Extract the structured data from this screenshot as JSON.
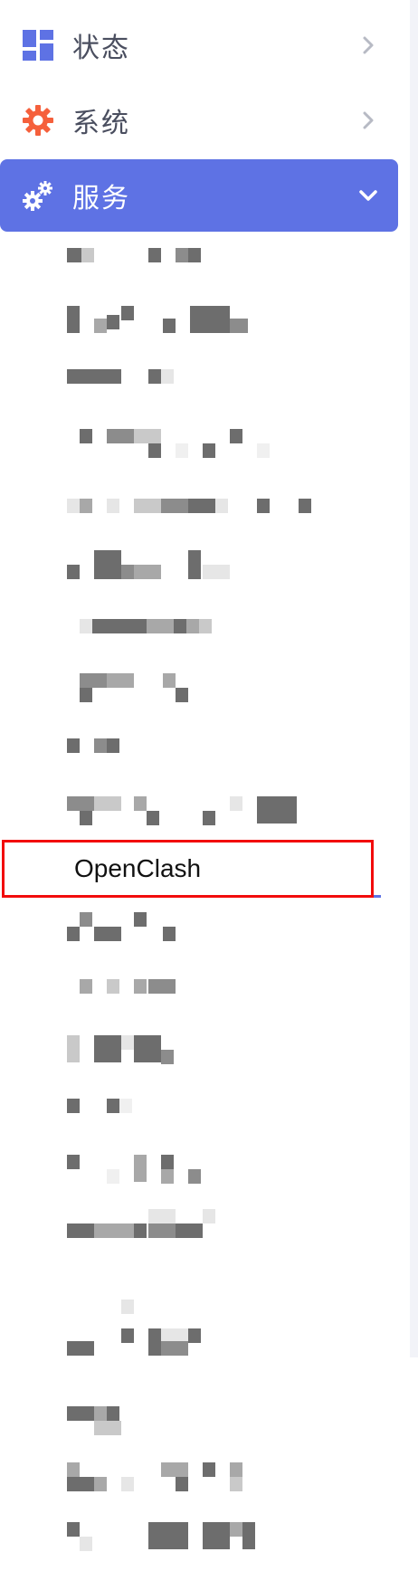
{
  "nav": {
    "status": {
      "label": "状态",
      "icon": "dashboard-icon"
    },
    "system": {
      "label": "系统",
      "icon": "gear-icon"
    },
    "services": {
      "label": "服务",
      "icon": "gears-icon",
      "expanded": true
    }
  },
  "submenu": {
    "highlighted_item": "OpenClash"
  },
  "colors": {
    "accent": "#5e72e4",
    "system_icon": "#f5603c",
    "highlight_border": "#f20c0c",
    "text": "#4a4e5f"
  }
}
